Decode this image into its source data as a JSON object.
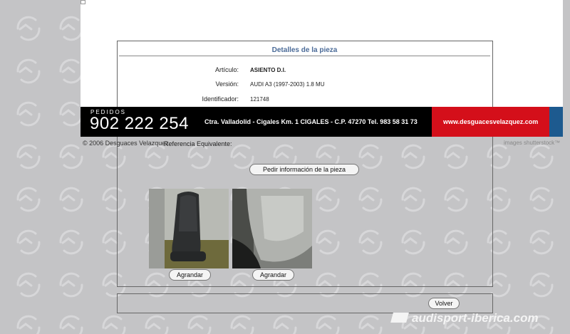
{
  "detail": {
    "title": "Detalles de la pieza",
    "fields": [
      {
        "label": "Artículo:",
        "value": "ASIENTO D.I."
      },
      {
        "label": "Versión:",
        "value": "AUDI A3 (1997-2003) 1.8 MU"
      },
      {
        "label": "Identificador:",
        "value": "121748"
      }
    ],
    "ref_label": "Referencia Equivalente:",
    "request_button": "Pedir información de la pieza",
    "enlarge_buttons": [
      "Agrandar",
      "Agrandar"
    ],
    "back_button": "Volver"
  },
  "banner": {
    "pedidos": "PEDIDOS",
    "phone": "902 222 254",
    "address": "Ctra. Valladolid - Cigales Km. 1 CIGALES - C.P. 47270 Tel. 983 58 31 73",
    "website": "www.desguacesvelazquez.com",
    "colors": {
      "red": "#d40f1a",
      "blue": "#1d5a8f",
      "black": "#000000"
    }
  },
  "footer": {
    "copyright": "© 2006 Desguaces Velazquez",
    "images_credit": "images shutterstock™"
  },
  "watermark": {
    "text": "audisport-iberica.com"
  }
}
